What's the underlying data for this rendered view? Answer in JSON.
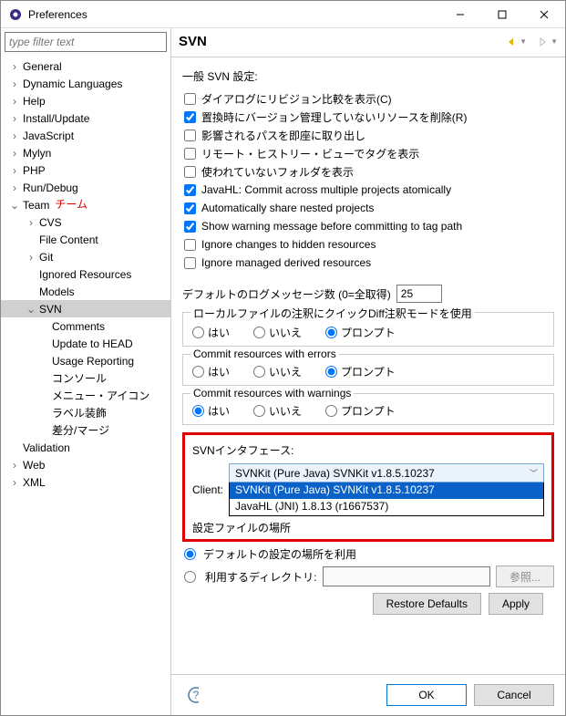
{
  "window": {
    "title": "Preferences"
  },
  "filter_placeholder": "type filter text",
  "tree": {
    "general": "General",
    "dyn": "Dynamic Languages",
    "help": "Help",
    "install": "Install/Update",
    "js": "JavaScript",
    "mylyn": "Mylyn",
    "php": "PHP",
    "rundebug": "Run/Debug",
    "team": "Team",
    "team_anno": "チーム",
    "cvs": "CVS",
    "filecontent": "File Content",
    "git": "Git",
    "ignored": "Ignored Resources",
    "models": "Models",
    "svn": "SVN",
    "comments": "Comments",
    "updatehead": "Update to HEAD",
    "usage": "Usage Reporting",
    "console": "コンソール",
    "menuicon": "メニュー・アイコン",
    "labeldeco": "ラベル装飾",
    "diffmerge": "差分/マージ",
    "validation": "Validation",
    "web": "Web",
    "xml": "XML"
  },
  "page": {
    "title": "SVN",
    "section_general": "一般 SVN 設定:",
    "checks": {
      "c1": "ダイアログにリビジョン比較を表示(C)",
      "c2": "置換時にバージョン管理していないリソースを削除(R)",
      "c3": "影響されるパスを即座に取り出し",
      "c4": "リモート・ヒストリー・ビューでタグを表示",
      "c5": "使われていないフォルダを表示",
      "c6": "JavaHL: Commit across multiple projects atomically",
      "c7": "Automatically share nested projects",
      "c8": "Show warning message before committing to tag path",
      "c9": "Ignore changes to hidden resources",
      "c10": "Ignore managed derived resources"
    },
    "logcount_label": "デフォルトのログメッセージ数 (0=全取得)",
    "logcount_value": "25",
    "grp_quickdiff": "ローカルファイルの注釈にクイックDiff注釈モードを使用",
    "grp_err": "Commit resources with errors",
    "grp_warn": "Commit resources with warnings",
    "radio_yes": "はい",
    "radio_no": "いいえ",
    "radio_prompt": "プロンプト",
    "svn_interface": "SVNインタフェース:",
    "client_label": "Client:",
    "client_selected": "SVNKit (Pure Java) SVNKit v1.8.5.10237",
    "client_opt1": "SVNKit (Pure Java) SVNKit v1.8.5.10237",
    "client_opt2": "JavaHL (JNI) 1.8.13 (r1667537)",
    "config_truncated": "設定ファイルの場所",
    "loc_default": "デフォルトの設定の場所を利用",
    "loc_usedir": "利用するディレクトリ:",
    "browse": "参照...",
    "restore": "Restore Defaults",
    "apply": "Apply",
    "ok": "OK",
    "cancel": "Cancel"
  }
}
